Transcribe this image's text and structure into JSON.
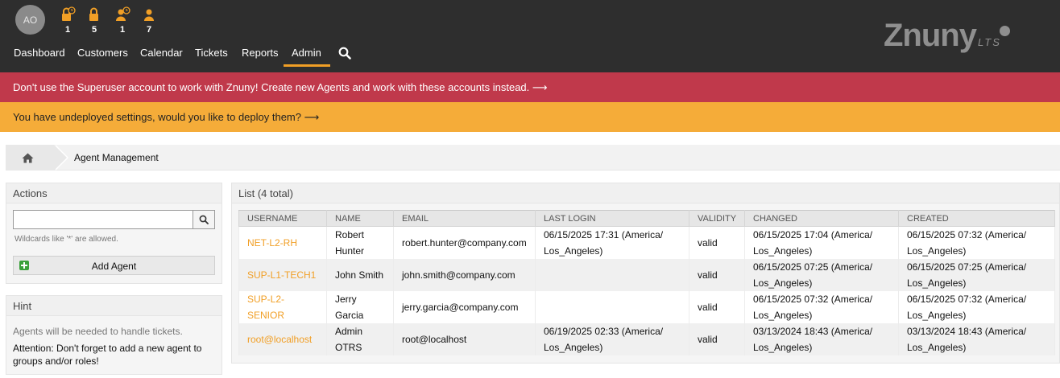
{
  "header": {
    "avatar_initials": "AO",
    "toolbar": [
      {
        "icon": "lock-clock-icon",
        "count": "1"
      },
      {
        "icon": "lock-icon",
        "count": "5"
      },
      {
        "icon": "person-clock-icon",
        "count": "1"
      },
      {
        "icon": "person-icon",
        "count": "7"
      }
    ],
    "nav": [
      "Dashboard",
      "Customers",
      "Calendar",
      "Tickets",
      "Reports",
      "Admin"
    ],
    "active_nav": "Admin",
    "logo_text": "Znuny",
    "logo_suffix": "LTS",
    "accent_color": "#f19f26"
  },
  "notices": {
    "superuser": "Don't use the Superuser account to work with Znuny! Create new Agents and work with these accounts instead. ⟶",
    "undeployed": "You have undeployed settings, would you like to deploy them? ⟶"
  },
  "breadcrumb": {
    "current": "Agent Management"
  },
  "actions": {
    "title": "Actions",
    "search_value": "",
    "wildcard_hint": "Wildcards like '*' are allowed.",
    "add_agent_label": "Add Agent"
  },
  "hint": {
    "title": "Hint",
    "text": "Agents will be needed to handle tickets.",
    "attention": "Attention: Don't forget to add a new agent to groups and/or roles!"
  },
  "list": {
    "title": "List (4 total)",
    "columns": [
      "USERNAME",
      "NAME",
      "EMAIL",
      "LAST LOGIN",
      "VALIDITY",
      "CHANGED",
      "CREATED"
    ],
    "rows": [
      {
        "username": "NET-L2-RH",
        "name": "Robert Hunter",
        "email": "robert.hunter@company.com",
        "last_login": "06/15/2025 17:31 (America/ Los_Angeles)",
        "validity": "valid",
        "changed": "06/15/2025 17:04 (America/ Los_Angeles)",
        "created": "06/15/2025 07:32 (America/ Los_Angeles)"
      },
      {
        "username": "SUP-L1-TECH1",
        "name": "John Smith",
        "email": "john.smith@company.com",
        "last_login": "",
        "validity": "valid",
        "changed": "06/15/2025 07:25 (America/ Los_Angeles)",
        "created": "06/15/2025 07:25 (America/ Los_Angeles)"
      },
      {
        "username": "SUP-L2- SENIOR",
        "name": "Jerry Garcia",
        "email": "jerry.garcia@company.com",
        "last_login": "",
        "validity": "valid",
        "changed": "06/15/2025 07:32 (America/ Los_Angeles)",
        "created": "06/15/2025 07:32 (America/ Los_Angeles)"
      },
      {
        "username": "root@localhost",
        "name": "Admin OTRS",
        "email": "root@localhost",
        "last_login": "06/19/2025 02:33 (America/ Los_Angeles)",
        "validity": "valid",
        "changed": "03/13/2024 18:43 (America/ Los_Angeles)",
        "created": "03/13/2024 18:43 (America/ Los_Angeles)"
      }
    ]
  }
}
